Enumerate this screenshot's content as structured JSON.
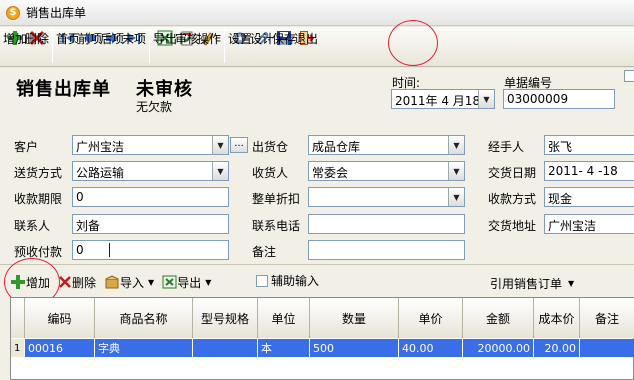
{
  "window": {
    "title": "销售出库单",
    "app_icon": "$"
  },
  "toolbar": [
    {
      "name": "add",
      "label": "增加",
      "icon": "plus-icon"
    },
    {
      "name": "delete",
      "label": "删除",
      "icon": "x-icon"
    },
    {
      "name": "first",
      "label": "首页",
      "icon": "first-icon"
    },
    {
      "name": "prev",
      "label": "前项",
      "icon": "prev-icon"
    },
    {
      "name": "next",
      "label": "后项",
      "icon": "next-icon"
    },
    {
      "name": "last",
      "label": "末项",
      "icon": "last-icon"
    },
    {
      "name": "export",
      "label": "导出",
      "icon": "excel-icon"
    },
    {
      "name": "audit",
      "label": "审核",
      "icon": "audit-icon"
    },
    {
      "name": "operate",
      "label": "操作",
      "icon": "pen-icon"
    },
    {
      "name": "settings",
      "label": "设置",
      "icon": "gear-icon"
    },
    {
      "name": "design",
      "label": "设计",
      "icon": "clip-icon"
    },
    {
      "name": "save",
      "label": "保存",
      "icon": "floppy-icon"
    },
    {
      "name": "exit",
      "label": "退出",
      "icon": "exit-icon"
    }
  ],
  "header": {
    "doc_title": "销售出库单",
    "status": "未审核",
    "payment_status": "无欠款",
    "time_label": "时间:",
    "time_value": "2011年 4 月18日",
    "docno_label": "单据编号",
    "docno_value": "03000009"
  },
  "form": {
    "customer_label": "客户",
    "customer_value": "广州宝洁",
    "customer_more": "...",
    "warehouse_label": "出货仓",
    "warehouse_value": "成品仓库",
    "handler_label": "经手人",
    "handler_value": "张飞",
    "shipping_label": "送货方式",
    "shipping_value": "公路运输",
    "receiver_label": "收货人",
    "receiver_value": "常委会",
    "delivery_date_label": "交货日期",
    "delivery_date_value": "2011- 4 -18",
    "payment_term_label": "收款期限",
    "payment_term_value": "0",
    "discount_label": "整单折扣",
    "discount_value": "",
    "payment_method_label": "收款方式",
    "payment_method_value": "现金",
    "contact_label": "联系人",
    "contact_value": "刘备",
    "phone_label": "联系电话",
    "phone_value": "",
    "address_label": "交货地址",
    "address_value": "广州宝洁",
    "prepaid_label": "预收付款",
    "prepaid_value": "0",
    "remark_label": "备注",
    "remark_value": ""
  },
  "detail_toolbar": {
    "add_label": "增加",
    "delete_label": "删除",
    "import_label": "导入",
    "export_label": "导出",
    "assist_label": "辅助输入",
    "ref_label": "引用销售订单"
  },
  "grid": {
    "columns": [
      "编码",
      "商品名称",
      "型号规格",
      "单位",
      "数量",
      "单价",
      "金额",
      "成本价",
      "备注"
    ],
    "rows": [
      {
        "idx": "1",
        "code": "00016",
        "name": "字典",
        "spec": "",
        "unit": "本",
        "qty": "500",
        "price": "40.00",
        "amount": "20000.00",
        "cost": "20.00",
        "note": ""
      }
    ]
  },
  "colors": {
    "accent_red": "#e0203a",
    "row_select": "#3a6ee8"
  }
}
